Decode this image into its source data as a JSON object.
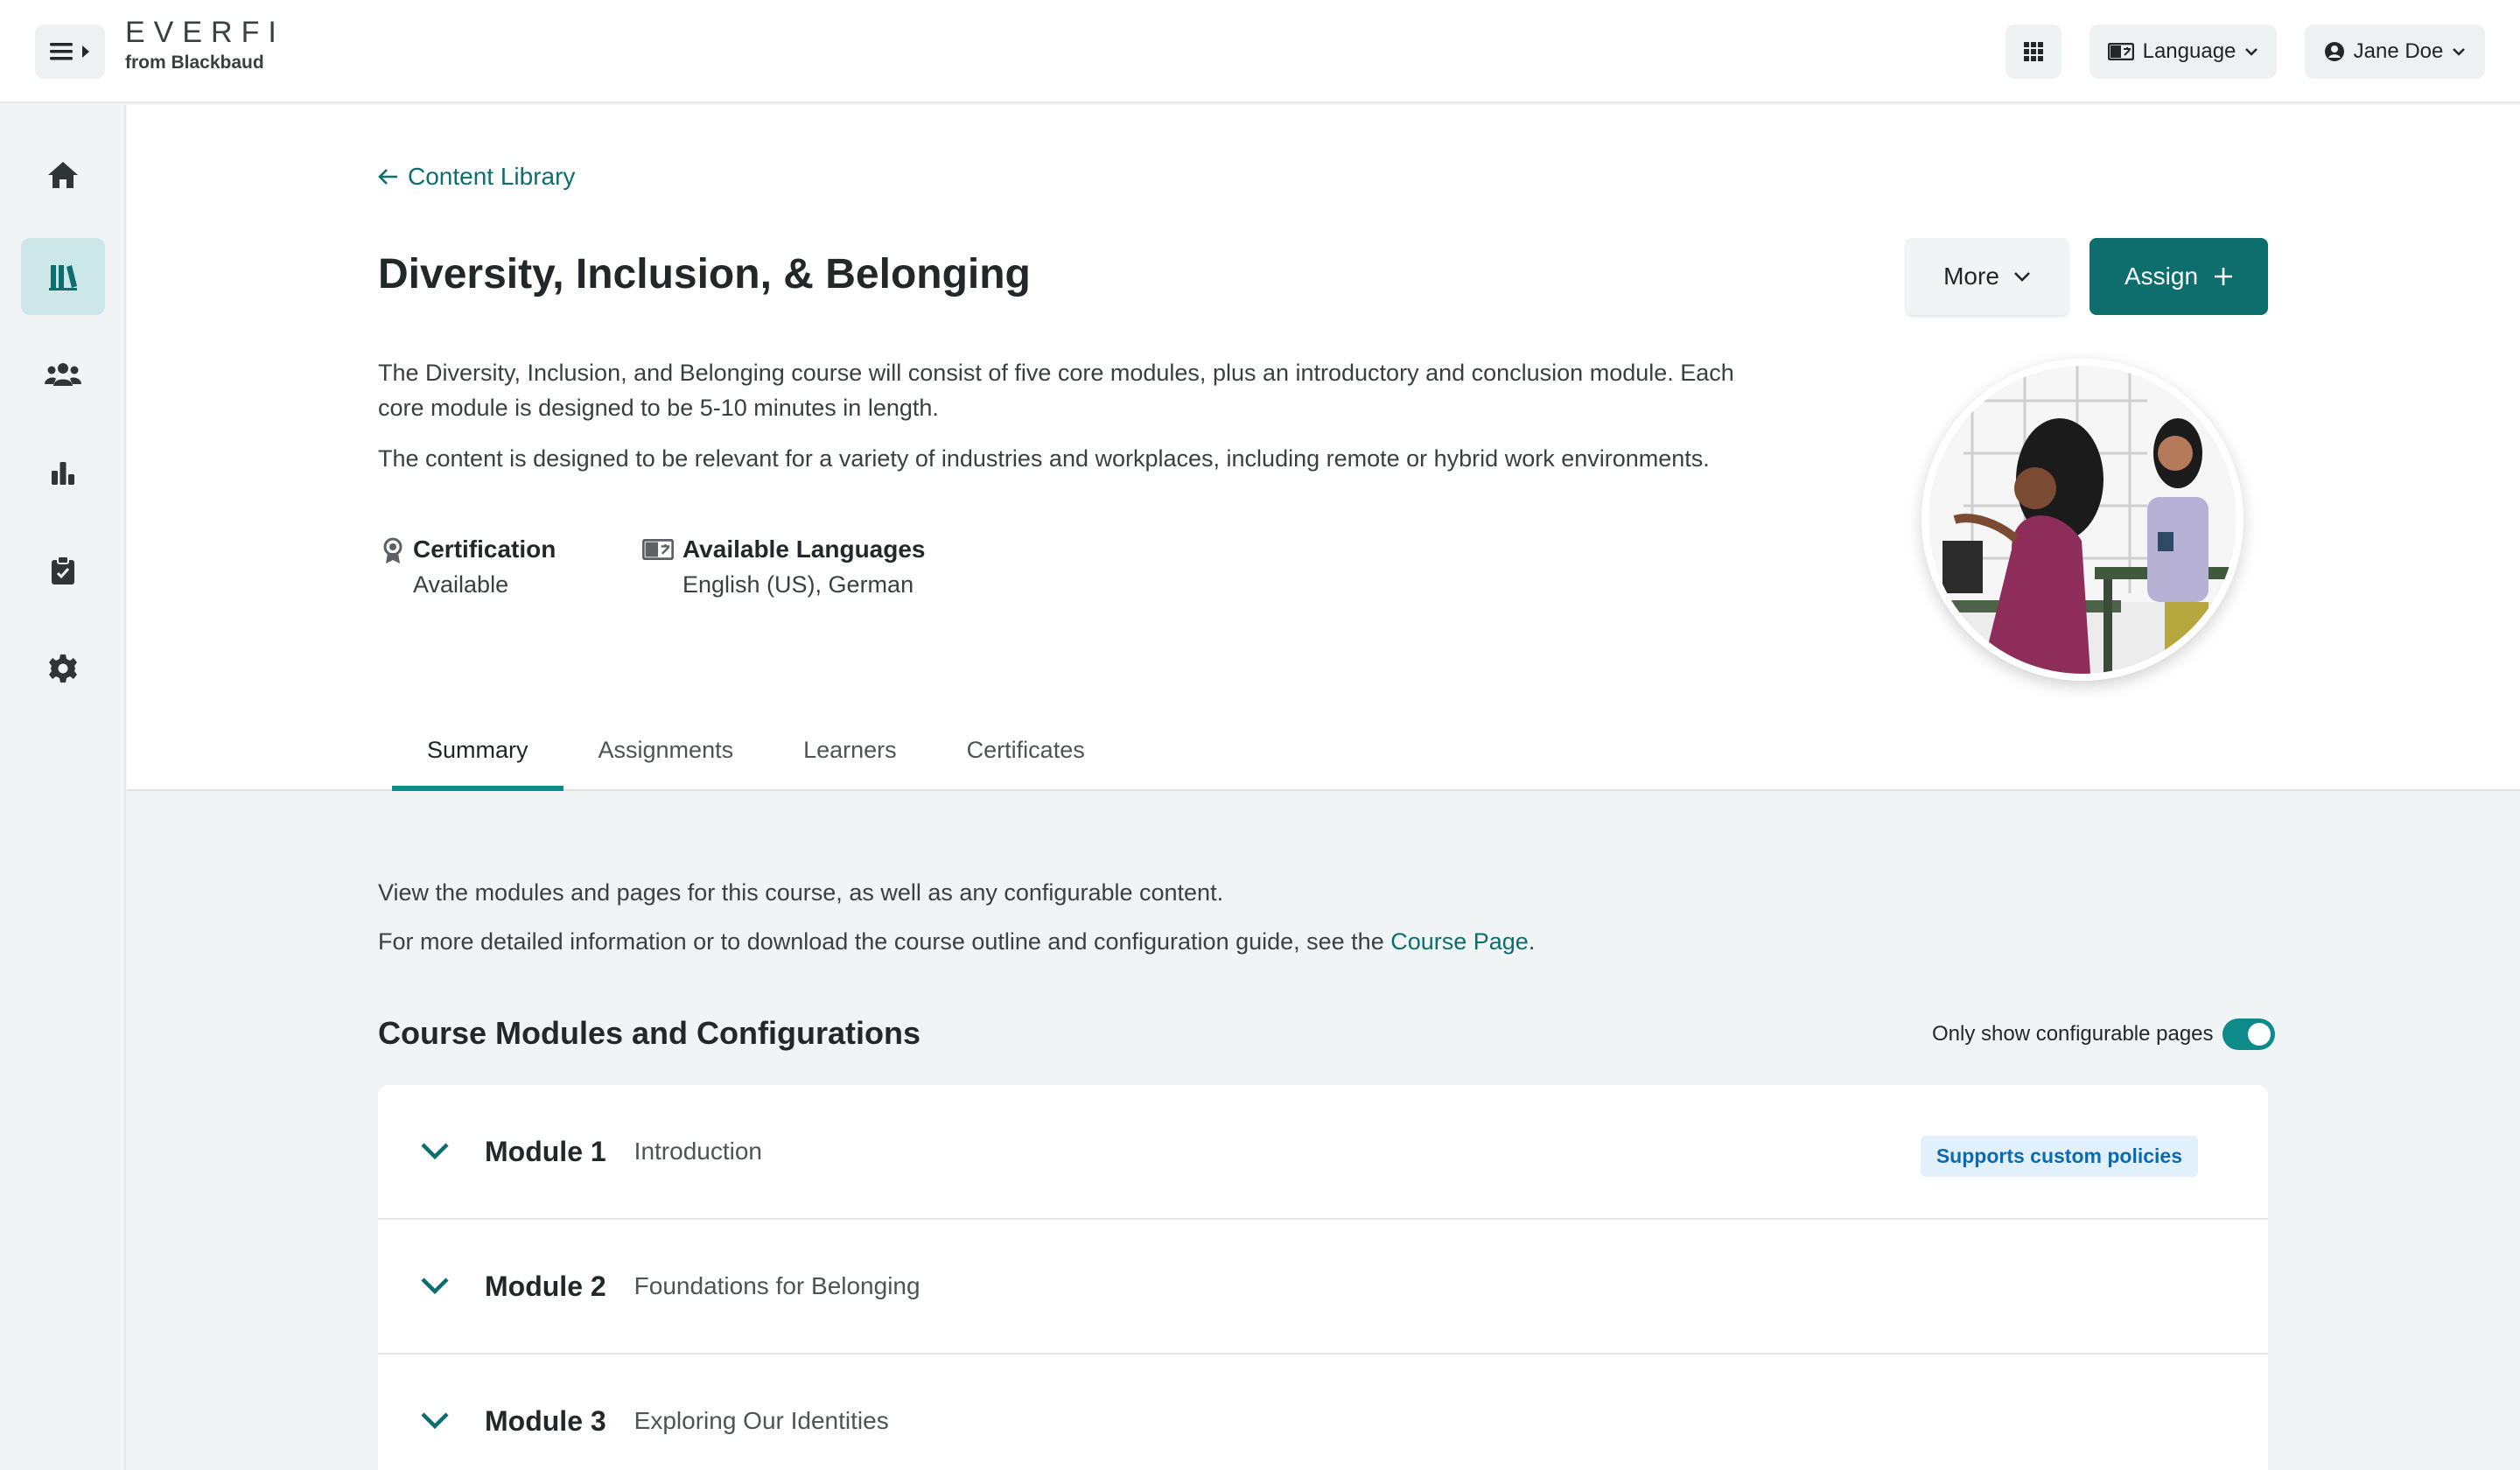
{
  "header": {
    "logo_main": "EVERFI",
    "logo_sub": "from Blackbaud",
    "language_label": "Language",
    "user_name": "Jane Doe"
  },
  "sidebar": {
    "items": [
      {
        "icon": "home-icon",
        "active": false
      },
      {
        "icon": "library-icon",
        "active": true
      },
      {
        "icon": "users-icon",
        "active": false
      },
      {
        "icon": "chart-icon",
        "active": false
      },
      {
        "icon": "clipboard-check-icon",
        "active": false
      },
      {
        "icon": "gear-icon",
        "active": false
      }
    ]
  },
  "course": {
    "back_link": "Content Library",
    "title": "Diversity, Inclusion, & Belonging",
    "more_label": "More",
    "assign_label": "Assign",
    "description_1": "The Diversity, Inclusion, and Belonging course will consist of five core modules, plus an introductory and conclusion module. Each core module is designed to be 5-10 minutes in length.",
    "description_2": "The content is designed to be relevant for a variety of industries and workplaces, including remote or hybrid work environments.",
    "certification_label": "Certification",
    "certification_value": "Available",
    "languages_label": "Available Languages",
    "languages_value": "English (US), German"
  },
  "tabs": [
    "Summary",
    "Assignments",
    "Learners",
    "Certificates"
  ],
  "active_tab": "Summary",
  "summary": {
    "intro": "View the modules and pages for this course, as well as any configurable content.",
    "detail_prefix": "For more detailed information or to download the course outline and configuration guide, see the ",
    "detail_link": "Course Page",
    "detail_suffix": ".",
    "section_title": "Course Modules and Configurations",
    "toggle_label": "Only show configurable pages",
    "toggle_on": true
  },
  "modules": [
    {
      "number": "Module 1",
      "name": "Introduction",
      "badge": "Supports custom policies"
    },
    {
      "number": "Module 2",
      "name": "Foundations for Belonging",
      "badge": ""
    },
    {
      "number": "Module 3",
      "name": "Exploring Our Identities",
      "badge": ""
    }
  ],
  "colors": {
    "accent": "#0e6e6e",
    "toggle": "#0e8a8a",
    "badge_bg": "#e2f0fb",
    "badge_text": "#0b6bb0"
  }
}
